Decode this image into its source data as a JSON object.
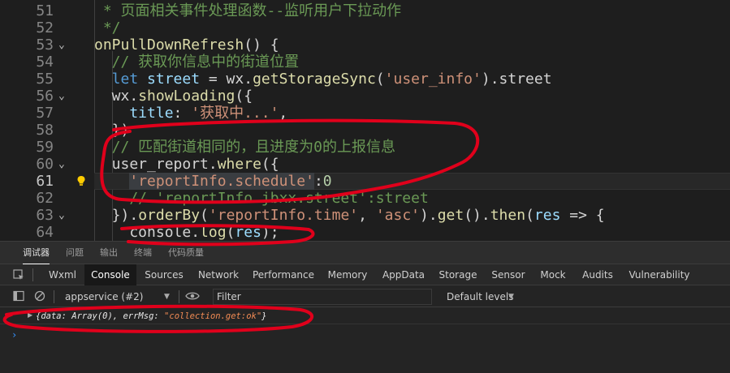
{
  "editor": {
    "lines": [
      {
        "num": "51",
        "fold": "",
        "html_key": "l51"
      },
      {
        "num": "52",
        "fold": "",
        "html_key": "l52"
      },
      {
        "num": "53",
        "fold": "v",
        "html_key": "l53"
      },
      {
        "num": "54",
        "fold": "",
        "html_key": "l54"
      },
      {
        "num": "55",
        "fold": "",
        "html_key": "l55"
      },
      {
        "num": "56",
        "fold": "v",
        "html_key": "l56"
      },
      {
        "num": "57",
        "fold": "",
        "html_key": "l57"
      },
      {
        "num": "58",
        "fold": "",
        "html_key": "l58"
      },
      {
        "num": "59",
        "fold": "",
        "html_key": "l59"
      },
      {
        "num": "60",
        "fold": "v",
        "html_key": "l60"
      },
      {
        "num": "61",
        "fold": "",
        "html_key": "l61"
      },
      {
        "num": "62",
        "fold": "",
        "html_key": "l62"
      },
      {
        "num": "63",
        "fold": "v",
        "html_key": "l63"
      },
      {
        "num": "64",
        "fold": "",
        "html_key": "l64"
      }
    ],
    "code": {
      "l51": " * 页面相关事件处理函数--监听用户下拉动作",
      "l52": " */",
      "l53a": "onPullDownRefresh",
      "l53b": "() {",
      "l54": "  // 获取你信息中的街道位置",
      "l55a": "  let",
      "l55b": " street",
      "l55c": " = wx.",
      "l55d": "getStorageSync",
      "l55e": "(",
      "l55f": "'user_info'",
      "l55g": ").street",
      "l56a": "  wx.",
      "l56b": "showLoading",
      "l56c": "({",
      "l57a": "    title",
      "l57b": ": ",
      "l57c": "'获取中...'",
      "l57d": ",",
      "l58": "  })",
      "l59": "  // 匹配街道相同的，且进度为0的上报信息",
      "l60a": "  user_report.",
      "l60b": "where",
      "l60c": "({",
      "l61a": "    ",
      "l61b": "'reportInfo.schedule'",
      "l61c": ":",
      "l61d": "0",
      "l62": "    // 'reportInfo.jbxx.street':street",
      "l63a": "  }).",
      "l63b": "orderBy",
      "l63c": "(",
      "l63d": "'reportInfo.time'",
      "l63e": ", ",
      "l63f": "'asc'",
      "l63g": ").",
      "l63h": "get",
      "l63i": "().",
      "l63j": "then",
      "l63k": "(",
      "l63l": "res",
      "l63m": " => {",
      "l64a": "    console.",
      "l64b": "log",
      "l64c": "(",
      "l64d": "res",
      "l64e": ");"
    }
  },
  "panel_tabs": [
    "调试器",
    "问题",
    "输出",
    "终端",
    "代码质量"
  ],
  "devtools_tabs": [
    "Wxml",
    "Console",
    "Sources",
    "Network",
    "Performance",
    "Memory",
    "AppData",
    "Storage",
    "Sensor",
    "Mock",
    "Audits",
    "Vulnerability"
  ],
  "console": {
    "context": "appservice (#2)",
    "filter_placeholder": "Filter",
    "levels": "Default levels",
    "log_prefix": "{data: Array(0), errMsg: ",
    "log_str": "\"collection.get:ok\"",
    "log_suffix": "}",
    "prompt": "›"
  },
  "colors": {
    "annotation": "#e0001b",
    "comment": "#6a9955",
    "function": "#dcdcaa",
    "string": "#ce9178",
    "keyword": "#569cd6"
  }
}
